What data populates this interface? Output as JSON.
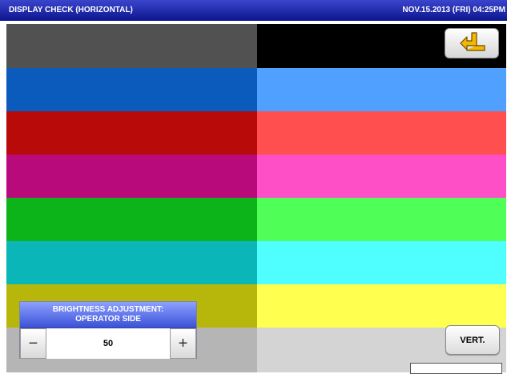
{
  "header": {
    "title": "DISPLAY CHECK (HORIZONTAL)",
    "datetime": "NOV.15.2013 (FRI)  04:25PM"
  },
  "colors": {
    "header_bg": "#0c168f",
    "bands": [
      [
        "#515151",
        "#000000"
      ],
      [
        "#0a5bbb",
        "#4fa0ff"
      ],
      [
        "#b90a0a",
        "#ff4f4f"
      ],
      [
        "#b90a7c",
        "#ff4fc6"
      ],
      [
        "#0db419",
        "#4fff58"
      ],
      [
        "#0ab6b7",
        "#4fffff"
      ],
      [
        "#b7b60a",
        "#ffff4f"
      ],
      [
        "#b5b5b5",
        "#d4d4d4"
      ]
    ]
  },
  "back_button": {
    "icon": "return-arrow-icon"
  },
  "brightness": {
    "label_line1": "BRIGHTNESS ADJUSTMENT:",
    "label_line2": "OPERATOR SIDE",
    "minus": "−",
    "plus": "+",
    "value": "50"
  },
  "vert_button": {
    "label": "VERT."
  },
  "status_field": {
    "value": ""
  }
}
